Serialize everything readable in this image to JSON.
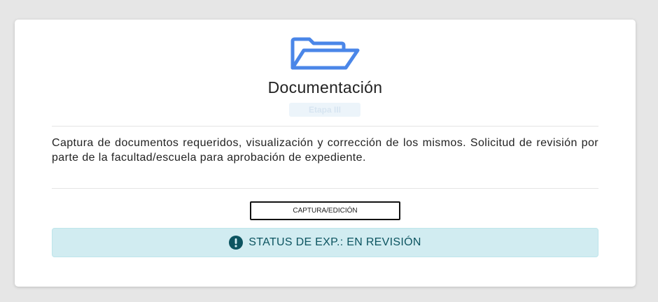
{
  "card": {
    "icon": "folder-open-icon",
    "title": "Documentación",
    "stage_badge": "Etapa III",
    "description": "Captura de documentos requeridos, visualización y corrección de los mismos. Solicitud de revisión por parte de la facultad/escuela para aprobación de expediente.",
    "action_button_label": "CAPTURA/EDICIÓN",
    "status": {
      "icon": "exclamation-circle-icon",
      "text": "STATUS DE EXP.: EN REVISIÓN"
    }
  },
  "colors": {
    "icon_blue": "#4a86e8",
    "status_background": "#d1ecf1",
    "status_text": "#0c5460"
  }
}
